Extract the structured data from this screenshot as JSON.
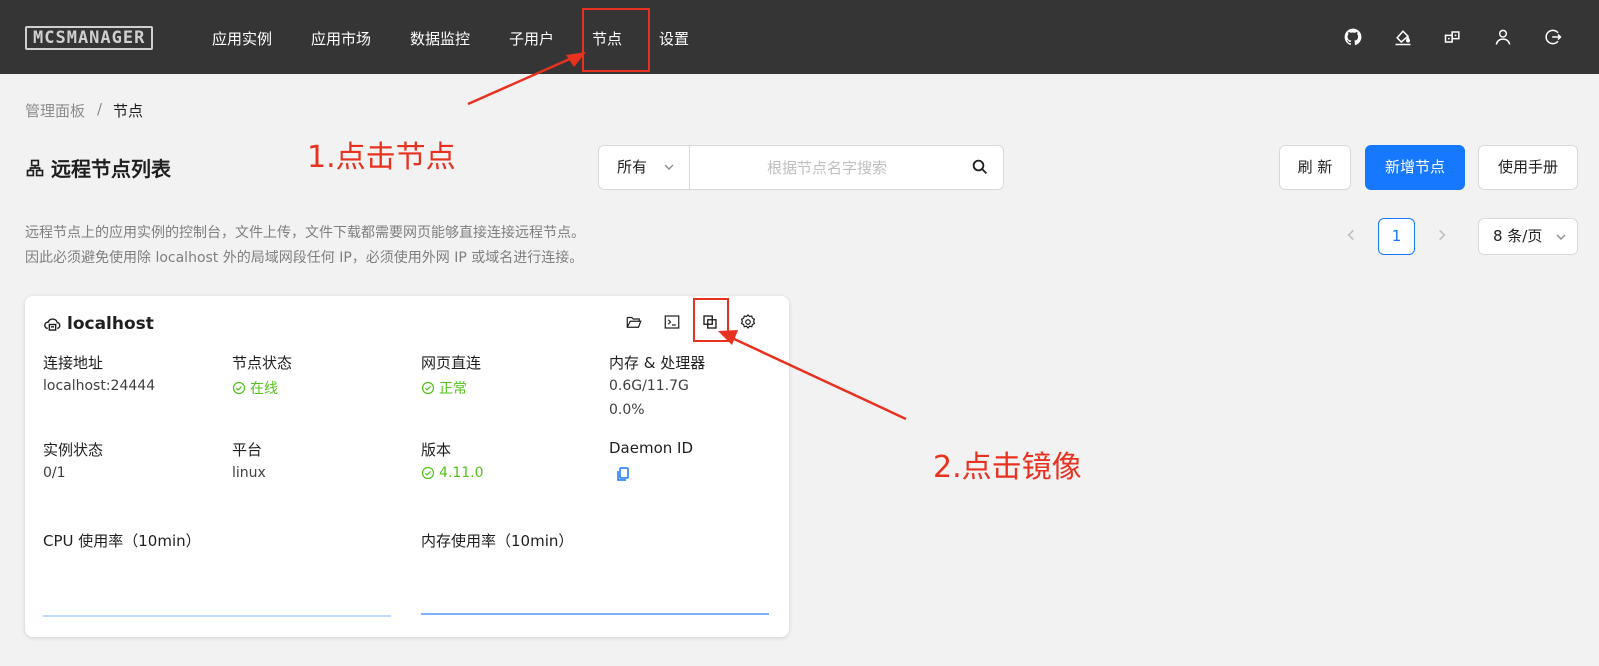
{
  "app": {
    "logo_text": "MCSMANAGER",
    "nav": [
      "应用实例",
      "应用市场",
      "数据监控",
      "子用户",
      "节点",
      "设置"
    ],
    "header_icons": [
      "github-icon",
      "theme-brush-icon",
      "language-icon",
      "user-icon",
      "logout-icon"
    ]
  },
  "breadcrumb": [
    "管理面板",
    "/",
    "节点"
  ],
  "page": {
    "title": "远程节点列表",
    "title_icon": "cluster-icon",
    "filter_selected": "所有",
    "search_placeholder": "根据节点名字搜索",
    "buttons": {
      "refresh": "刷 新",
      "add_node": "新增节点",
      "manual": "使用手册"
    },
    "description": [
      "远程节点上的应用实例的控制台，文件上传，文件下载都需要网页能够直接连接远程节点。",
      "因此必须避免使用除 localhost 外的局域网段任何 IP，必须使用外网 IP 或域名进行连接。"
    ],
    "pagination": {
      "current_page": "1",
      "page_size": "8 条/页"
    }
  },
  "node_card": {
    "name": "localhost",
    "actions": [
      "folder-open-icon",
      "terminal-icon",
      "image-copy-icon",
      "settings-icon"
    ],
    "fields": {
      "address": {
        "label": "连接地址",
        "value": "localhost:24444"
      },
      "status": {
        "label": "节点状态",
        "value": "在线"
      },
      "direct": {
        "label": "网页直连",
        "value": "正常"
      },
      "memory_cpu": {
        "label": "内存 & 处理器",
        "memory": "0.6G/11.7G",
        "cpu": "0.0%"
      },
      "instances": {
        "label": "实例状态",
        "value": "0/1"
      },
      "platform": {
        "label": "平台",
        "value": "linux"
      },
      "version": {
        "label": "版本",
        "value": "4.11.0"
      },
      "daemon_id": {
        "label": "Daemon ID"
      }
    },
    "charts": {
      "cpu_label": "CPU 使用率（10min）",
      "mem_label": "内存使用率（10min）"
    }
  },
  "annotations": {
    "step1": "1.点击节点",
    "step2": "2.点击镜像",
    "color": "#e8311f"
  },
  "colors": {
    "primary": "#1677ff",
    "success": "#52c41a",
    "topbar": "#353535"
  }
}
